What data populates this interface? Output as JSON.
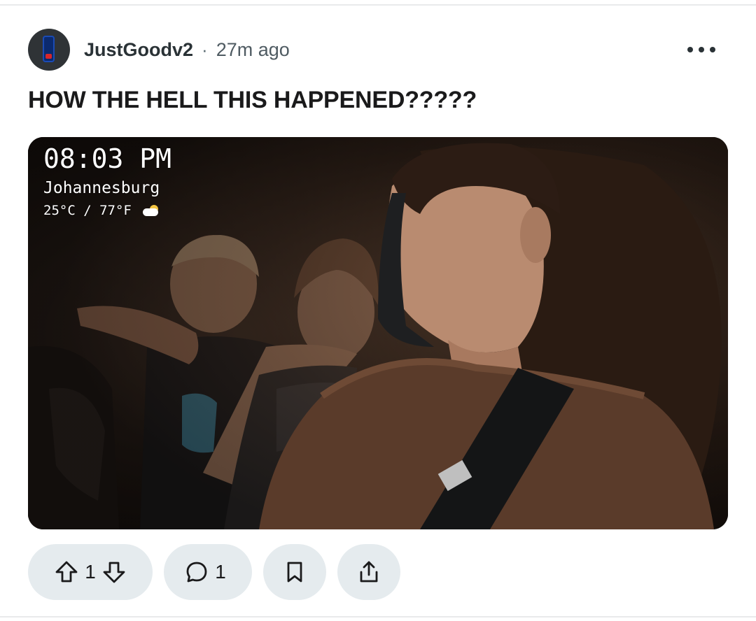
{
  "post": {
    "author": "JustGoodv2",
    "separator": "·",
    "time_ago": "27m ago",
    "title": "HOW THE HELL THIS HAPPENED?????",
    "media_overlay": {
      "time": "08:03 PM",
      "city": "Johannesburg",
      "temperature": "25°C / 77°F",
      "weather_icon": "partly-cloudy-icon"
    },
    "votes": "1",
    "comments": "1",
    "icons": {
      "upvote": "arrow-up-icon",
      "downvote": "arrow-down-icon",
      "comment": "speech-bubble-icon",
      "save": "bookmark-icon",
      "share": "share-icon",
      "more": "more-horizontal-icon"
    }
  },
  "colors": {
    "pill_background": "#e5ebee",
    "text_primary": "#1a1a1b",
    "text_secondary": "#4f5b62"
  }
}
